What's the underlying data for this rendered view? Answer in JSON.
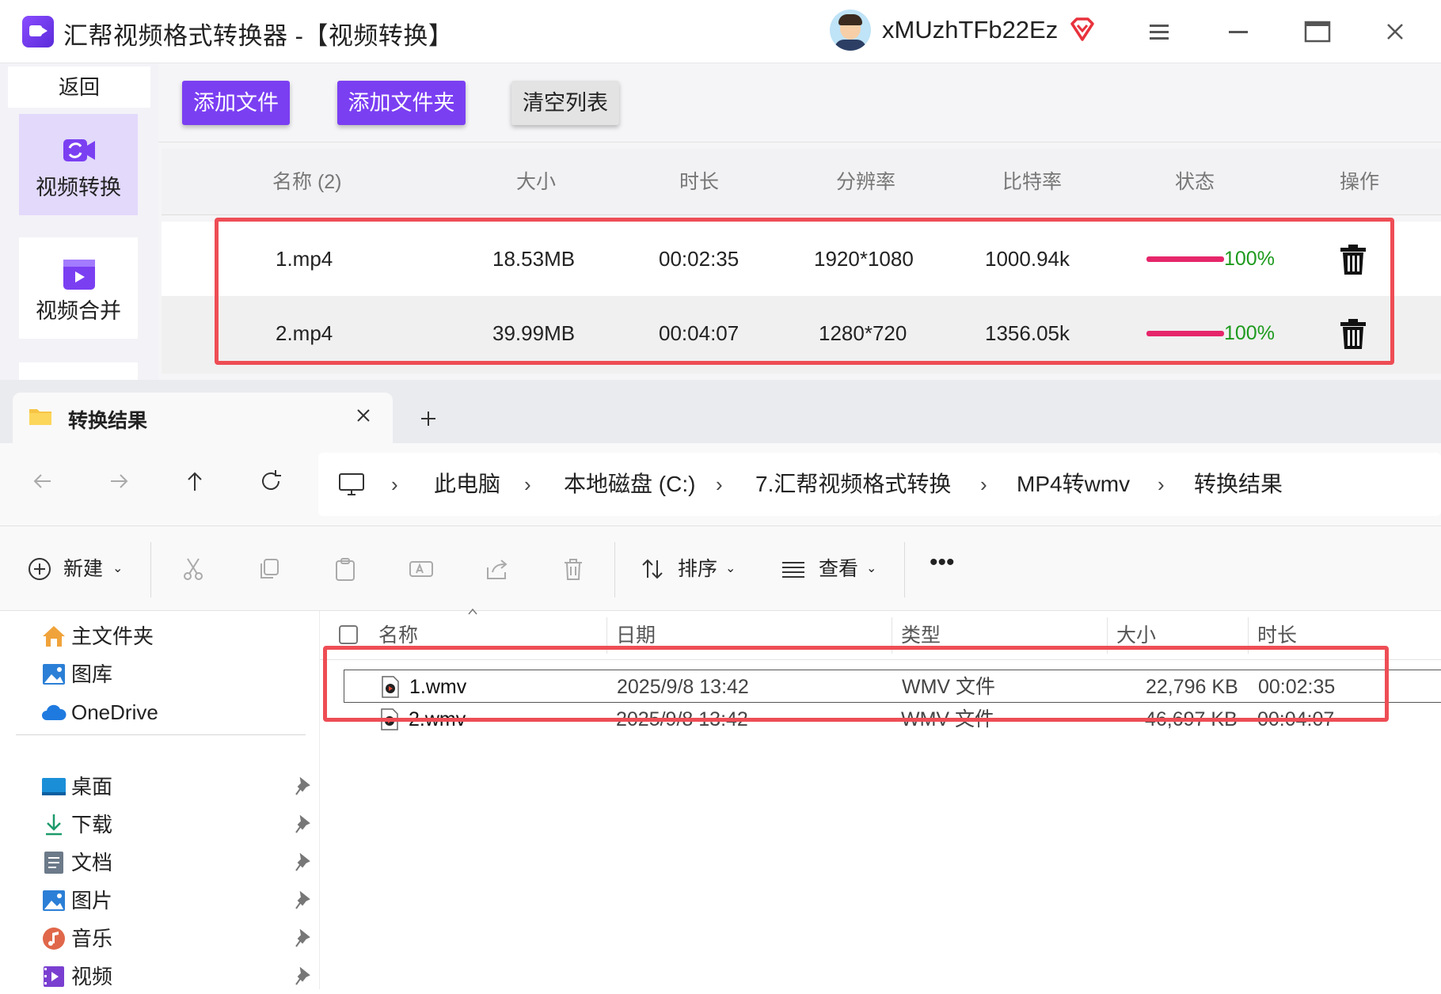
{
  "app": {
    "title": "汇帮视频格式转换器  -【视频转换】",
    "username": "xMUzhTFb22Ez",
    "accent": "#7b3ff2",
    "icons": {
      "logo": "video-camera-icon",
      "vip": "diamond-icon",
      "menu": "hamburger-icon",
      "minimize": "minimize-icon",
      "maximize": "maximize-icon",
      "close": "close-icon"
    }
  },
  "sidebar": {
    "back_label": "返回",
    "items": [
      {
        "label": "视频转换",
        "icon": "video-convert-icon",
        "active": true
      },
      {
        "label": "视频合并",
        "icon": "video-merge-icon",
        "active": false
      }
    ]
  },
  "toolbar": {
    "add_file": "添加文件",
    "add_folder": "添加文件夹",
    "clear_list": "清空列表"
  },
  "table": {
    "headers": [
      "名称 (2)",
      "大小",
      "时长",
      "分辨率",
      "比特率",
      "状态",
      "操作"
    ],
    "rows": [
      {
        "name": "1.mp4",
        "size": "18.53MB",
        "duration": "00:02:35",
        "resolution": "1920*1080",
        "bitrate": "1000.94k",
        "progress": 1.0,
        "status": "100%"
      },
      {
        "name": "2.mp4",
        "size": "39.99MB",
        "duration": "00:04:07",
        "resolution": "1280*720",
        "bitrate": "1356.05k",
        "progress": 1.0,
        "status": "100%"
      }
    ],
    "progress_color": "#e6266a",
    "status_color": "#1d9a1d"
  },
  "explorer": {
    "tab_title": "转换结果",
    "breadcrumbs": [
      "此电脑",
      "本地磁盘 (C:)",
      "7.汇帮视频格式转换",
      "MP4转wmv",
      "转换结果"
    ],
    "commands": {
      "new": "新建",
      "sort": "排序",
      "view": "查看"
    },
    "nav_top": [
      {
        "label": "主文件夹",
        "icon": "home-icon"
      },
      {
        "label": "图库",
        "icon": "gallery-icon"
      },
      {
        "label": "OneDrive",
        "icon": "cloud-icon"
      }
    ],
    "nav_pinned": [
      {
        "label": "桌面",
        "icon": "desktop-icon"
      },
      {
        "label": "下载",
        "icon": "download-icon"
      },
      {
        "label": "文档",
        "icon": "document-icon"
      },
      {
        "label": "图片",
        "icon": "picture-icon"
      },
      {
        "label": "音乐",
        "icon": "music-icon"
      },
      {
        "label": "视频",
        "icon": "video-icon"
      }
    ],
    "columns": [
      "名称",
      "日期",
      "类型",
      "大小",
      "时长"
    ],
    "files": [
      {
        "name": "1.wmv",
        "date": "2025/9/8 13:42",
        "type": "WMV 文件",
        "size": "22,796 KB",
        "duration": "00:02:35"
      },
      {
        "name": "2.wmv",
        "date": "2025/9/8 13:42",
        "type": "WMV 文件",
        "size": "46,697 KB",
        "duration": "00:04:07"
      }
    ],
    "highlight_color": "#ee4d55"
  }
}
